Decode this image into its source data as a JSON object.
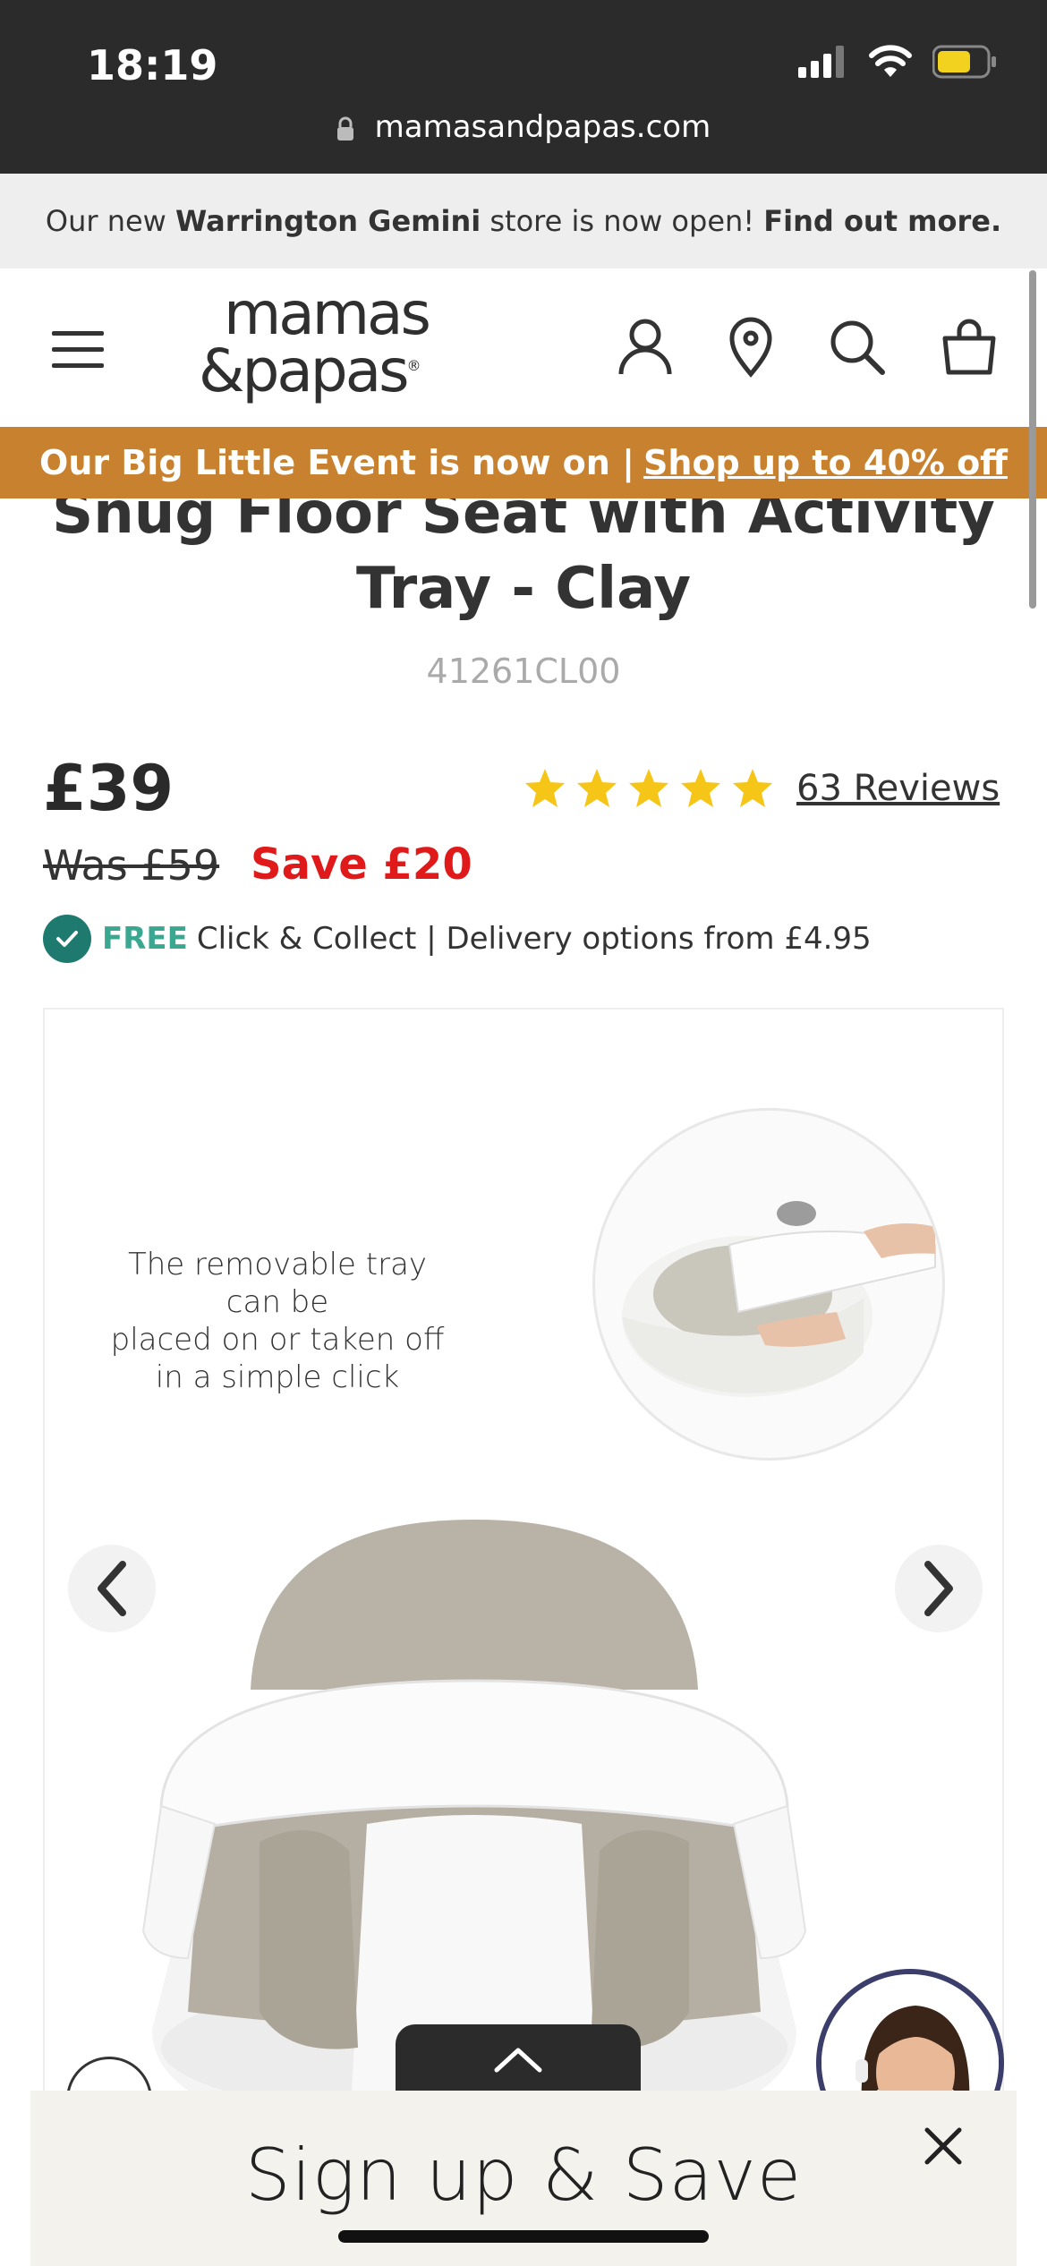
{
  "status_bar": {
    "time": "18:19",
    "url": "mamasandpapas.com"
  },
  "announcement": {
    "prefix": "Our new",
    "store": "Warrington Gemini",
    "middle": "store is now open!",
    "link": "Find out more."
  },
  "header": {
    "logo_line1": "mamas",
    "logo_line2": "&papas",
    "logo_mark": "®"
  },
  "promo": {
    "text": "Our Big Little Event is now on |",
    "link": "Shop up to 40% off"
  },
  "product": {
    "title_line1": "Snug Floor Seat with Activity",
    "title_line2": "Tray - Clay",
    "sku": "41261CL00",
    "price": "£39",
    "was_price": "Was £59",
    "save": "Save £20",
    "rating": 5,
    "reviews": "63 Reviews",
    "delivery_free": "FREE",
    "delivery_text": "Click & Collect | Delivery options from £4.95"
  },
  "gallery": {
    "caption_line1": "The removable tray can be",
    "caption_line2": "placed on or taken off",
    "caption_line3": "in a simple click"
  },
  "signup": {
    "title": "Sign up & Save"
  },
  "colors": {
    "promo": "#c8822f",
    "save": "#e01a1a",
    "star": "#f5c518",
    "check": "#1e7a6e",
    "free": "#3aa890"
  }
}
